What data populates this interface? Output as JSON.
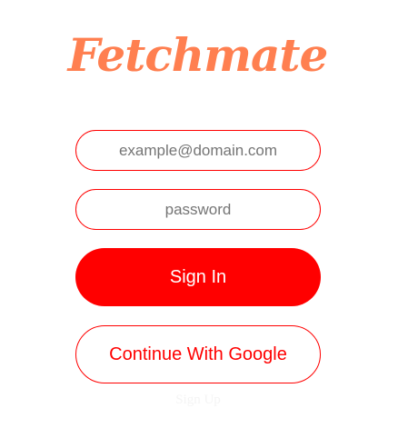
{
  "app": {
    "logo_text": "Fetchmate",
    "brand_color": "#FF7F50",
    "accent_color": "#FF0000"
  },
  "login_form": {
    "email_placeholder": "example@domain.com",
    "email_value": "",
    "password_placeholder": "password",
    "password_value": "",
    "signin_label": "Sign In",
    "google_label": "Continue With Google",
    "signup_label": "Sign Up"
  }
}
